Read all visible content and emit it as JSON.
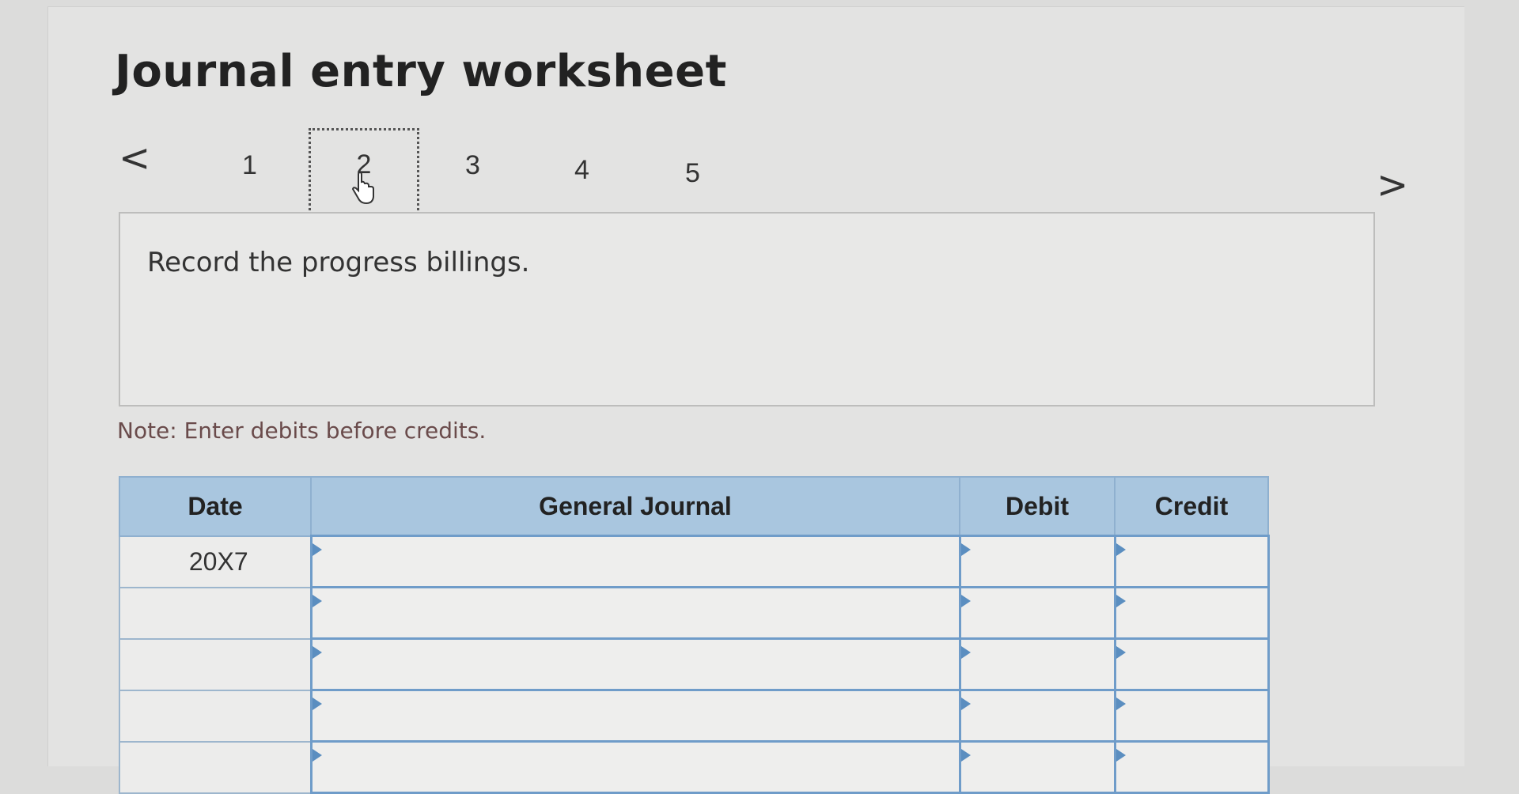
{
  "worksheet": {
    "title": "Journal entry worksheet",
    "steps": [
      "1",
      "2",
      "3",
      "4",
      "5"
    ],
    "active_step": "2",
    "instruction": "Record the progress billings.",
    "note": "Note: Enter debits before credits."
  },
  "table": {
    "headers": {
      "date": "Date",
      "journal": "General Journal",
      "debit": "Debit",
      "credit": "Credit"
    },
    "rows": [
      {
        "date": "20X7",
        "account": "",
        "debit": "",
        "credit": ""
      },
      {
        "date": "",
        "account": "",
        "debit": "",
        "credit": ""
      },
      {
        "date": "",
        "account": "",
        "debit": "",
        "credit": ""
      },
      {
        "date": "",
        "account": "",
        "debit": "",
        "credit": ""
      },
      {
        "date": "",
        "account": "",
        "debit": "",
        "credit": ""
      }
    ]
  },
  "icons": {
    "prev": "chevron-left-icon",
    "next": "chevron-right-icon",
    "cursor": "hand-pointer-icon"
  },
  "colors": {
    "header_bg": "#a9c6df",
    "input_border": "#6f9cc9",
    "note_text": "#6a4b4b"
  }
}
